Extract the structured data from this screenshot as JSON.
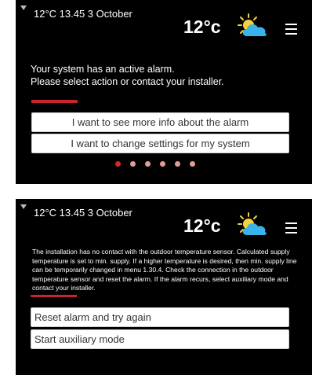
{
  "colors": {
    "screen_bg": "#000000",
    "text": "#ffffff",
    "button_bg": "#ffffff",
    "button_text": "#333333",
    "accent_red": "#c8262c",
    "dot_active": "#d6262b",
    "dot_inactive": "#e39a9a"
  },
  "screen1": {
    "status": "12°C 13.45 3 October",
    "temperature": "12°c",
    "weather_icon": "partly-cloudy-icon",
    "menu_icon": "hamburger-menu-icon",
    "message_line1": "Your system has an active alarm.",
    "message_line2": "Please select action or contact your installer.",
    "buttons": {
      "more_info": "I want to see more info about the alarm",
      "change_settings": "I want to change settings for my system"
    },
    "pagination": {
      "total": 6,
      "active": 1
    }
  },
  "screen2": {
    "status": "12°C 13.45 3 October",
    "temperature": "12°c",
    "weather_icon": "partly-cloudy-icon",
    "menu_icon": "hamburger-menu-icon",
    "alarm_text": "The installation has no contact with the outdoor temperature sensor. Calculated supply temperature is set to min. supply. If a higher temperature is desired, then min. supply line can be temporarily changed in menu 1.30.4. Check the connection in the outdoor temperature sensor and reset the alarm. If the alarm recurs, select auxiliary mode and contact your installer.",
    "buttons": {
      "reset_alarm": "Reset alarm and try again",
      "auxiliary_mode": "Start auxiliary mode"
    }
  }
}
